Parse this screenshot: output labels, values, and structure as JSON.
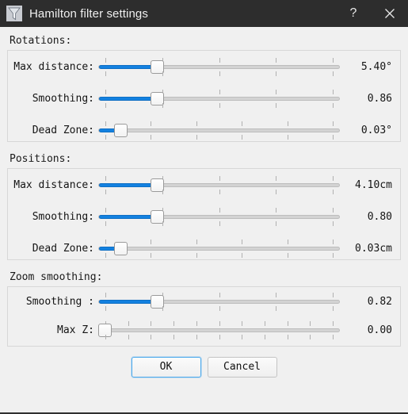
{
  "window": {
    "title": "Hamilton filter settings",
    "icon": "funnel-filter-icon",
    "help_label": "?",
    "close_label": "✕",
    "titlebar_color": "#2d2d2d",
    "background_color": "#f0f0f0",
    "accent_color": "#1381e0"
  },
  "groups": [
    {
      "title": "Rotations:",
      "rows": [
        {
          "label": "Max distance:",
          "value": "5.40°",
          "percent": 23,
          "ticks": 5
        },
        {
          "label": "Smoothing:",
          "value": "0.86",
          "percent": 23,
          "ticks": 5
        },
        {
          "label": "Dead Zone:",
          "value": "0.03°",
          "percent": 7,
          "ticks": 6
        }
      ]
    },
    {
      "title": "Positions:",
      "rows": [
        {
          "label": "Max distance:",
          "value": "4.10cm",
          "percent": 23,
          "ticks": 5
        },
        {
          "label": "Smoothing:",
          "value": "0.80",
          "percent": 23,
          "ticks": 5
        },
        {
          "label": "Dead Zone:",
          "value": "0.03cm",
          "percent": 7,
          "ticks": 6
        }
      ]
    },
    {
      "title": "Zoom smoothing:",
      "rows": [
        {
          "label": "Smoothing :",
          "value": "0.82",
          "percent": 23,
          "ticks": 5
        },
        {
          "label": "Max Z:",
          "value": "0.00",
          "percent": 0,
          "ticks": 11
        }
      ]
    }
  ],
  "footer": {
    "ok_label": "OK",
    "cancel_label": "Cancel"
  }
}
